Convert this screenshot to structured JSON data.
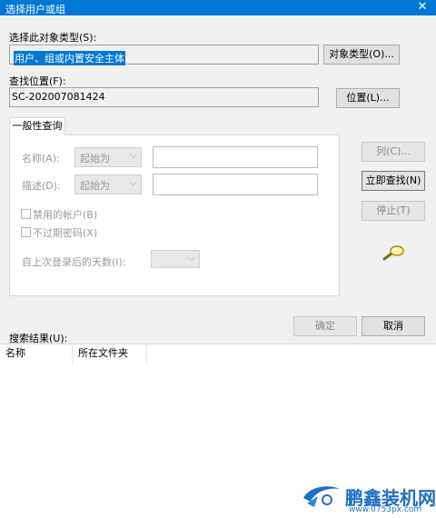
{
  "window": {
    "title": "选择用户或组",
    "close_glyph": "✕"
  },
  "object_type": {
    "label": "选择此对象类型(S):",
    "value": "用户、组或内置安全主体",
    "button": "对象类型(O)..."
  },
  "location": {
    "label": "查找位置(F):",
    "value": "SC-202007081424",
    "button": "位置(L)..."
  },
  "query_tab": {
    "label": "一般性查询"
  },
  "query": {
    "name_label": "名称(A):",
    "name_combo": "起始为",
    "desc_label": "描述(D):",
    "desc_combo": "起始为",
    "disabled_accounts": "禁用的帐户(B)",
    "non_expiring_pwd": "不过期密码(X)",
    "days_label": "自上次登录后的天数(I):"
  },
  "side_buttons": {
    "columns": "列(C)...",
    "find_now": "立即查找(N)",
    "stop": "停止(T)"
  },
  "footer": {
    "ok": "确定",
    "cancel": "取消"
  },
  "results": {
    "label": "搜索结果(U):",
    "columns": [
      "名称",
      "所在文件夹"
    ]
  },
  "watermark": {
    "brand": "鹏鑫装机网",
    "url": "www.0753px.com"
  },
  "colors": {
    "accent": "#0078d7",
    "background": "#f0f0f0"
  }
}
